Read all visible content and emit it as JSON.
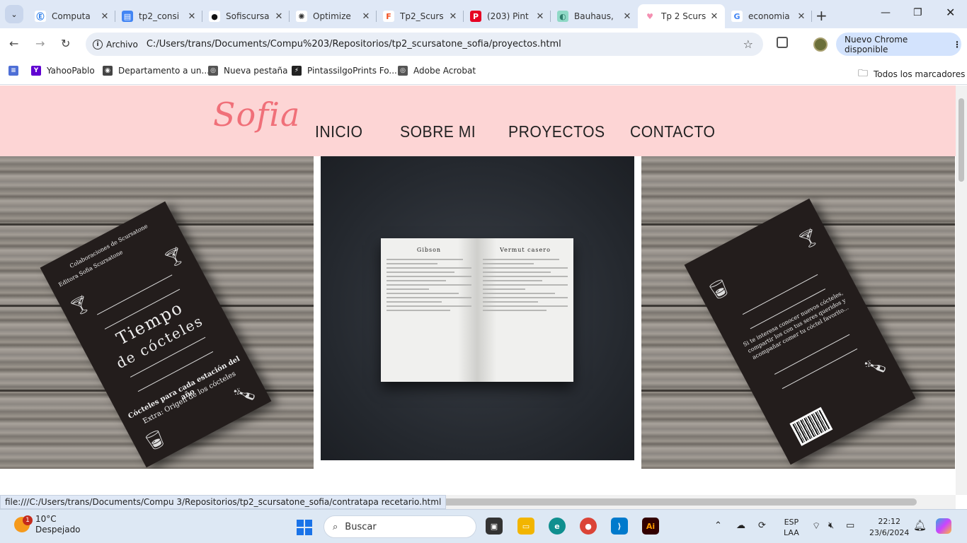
{
  "browser": {
    "tabs": [
      {
        "title": "Computa",
        "favicon": "Ⓔ",
        "fav_bg": "#ffffff",
        "fav_color": "#1a73e8"
      },
      {
        "title": "tp2_consi",
        "favicon": "▤",
        "fav_bg": "#4285f4",
        "fav_color": "#ffffff"
      },
      {
        "title": "Sofiscursa",
        "favicon": "●",
        "fav_bg": "#ffffff",
        "fav_color": "#111111"
      },
      {
        "title": "Optimize",
        "favicon": "✺",
        "fav_bg": "#ffffff",
        "fav_color": "#333333"
      },
      {
        "title": "Tp2_Scurs",
        "favicon": "F",
        "fav_bg": "#ffffff",
        "fav_color": "#f24e1e"
      },
      {
        "title": "(203) Pint",
        "favicon": "P",
        "fav_bg": "#e60023",
        "fav_color": "#ffffff"
      },
      {
        "title": "Bauhaus,",
        "favicon": "◐",
        "fav_bg": "#8fd9c6",
        "fav_color": "#2e7d6b"
      },
      {
        "title": "Tp 2 Scurs",
        "favicon": "♥",
        "fav_bg": "#ffffff",
        "fav_color": "#f48fb1"
      },
      {
        "title": "economia",
        "favicon": "G",
        "fav_bg": "#ffffff",
        "fav_color": "#4285f4"
      }
    ],
    "active_tab_index": 7,
    "address": {
      "chip_label": "Archivo",
      "url": "C:/Users/trans/Documents/Compu%203/Repositorios/tp2_scursatone_sofia/proyectos.html"
    },
    "update_button": "Nuevo Chrome disponible",
    "bookmarks": [
      {
        "label": "YahooPablo",
        "icon_bg": "#6001d2",
        "icon": "Y"
      },
      {
        "label": "Departamento a un...",
        "icon_bg": "#444444",
        "icon": "◉"
      },
      {
        "label": "Nueva pestaña",
        "icon_bg": "#555555",
        "icon": "◎"
      },
      {
        "label": "PintassilgoPrints Fo...",
        "icon_bg": "#222222",
        "icon": "⚡"
      },
      {
        "label": "Adobe Acrobat",
        "icon_bg": "#555555",
        "icon": "◎"
      }
    ],
    "all_bookmarks": "Todos los marcadores",
    "status_url": "file:///C:/Users/trans/Documents/Compu 3/Repositorios/tp2_scursatone_sofia/contratapa recetario.html"
  },
  "site": {
    "logo": "Sofia",
    "nav": [
      "INICIO",
      "SOBRE MI",
      "PROYECTOS",
      "CONTACTO"
    ],
    "colors": {
      "header_bg": "#fdd5d5",
      "logo": "#f07079"
    },
    "projects": [
      {
        "type": "book-cover",
        "publisher": "Editora Sofia Scursatone",
        "collab": "Colaboraciones de Scursatone",
        "title_line1": "Tiempo",
        "title_line2": "de cócteles",
        "subtitle": "Cócteles para cada estación del año",
        "extra": "Extra: Origen de los cócteles"
      },
      {
        "type": "open-recipe-book",
        "left_title": "Gibson",
        "right_title": "Vermut casero"
      },
      {
        "type": "book-back-cover",
        "blurb": "Si te interesa conocer nuevos cócteles, compartir los con tus seres queridos y acompañar comer tu cóctel favorito..."
      }
    ]
  },
  "taskbar": {
    "weather_temp": "10°C",
    "weather_desc": "Despejado",
    "weather_badge": "1",
    "search_placeholder": "Buscar",
    "language": "ESP",
    "layout": "LAA",
    "time": "22:12",
    "date": "23/6/2024"
  }
}
